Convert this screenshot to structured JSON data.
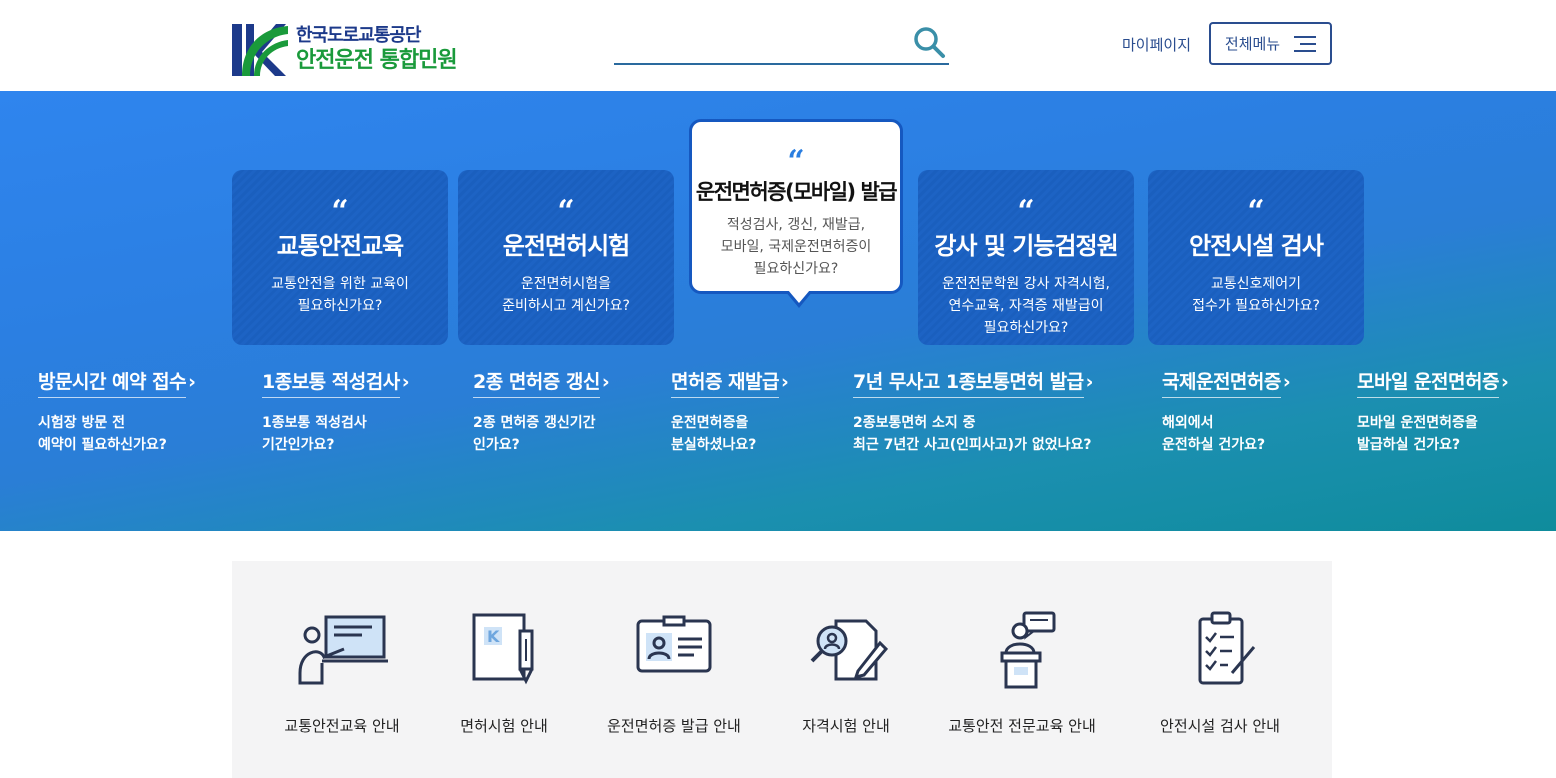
{
  "header": {
    "logo_line1": "한국도로교통공단",
    "logo_line2": "안전운전 통합민원",
    "search_placeholder": "",
    "mypage": "마이페이지",
    "menu": "전체메뉴"
  },
  "colors": {
    "brand_blue": "#1d3a8a",
    "brand_green": "#1a9a3b",
    "hero_blue": "#2b7fe2",
    "hero_teal": "#0f8c9c"
  },
  "cards": [
    {
      "title": "교통안전교육",
      "desc1": "교통안전을 위한 교육이",
      "desc2": "필요하신가요?",
      "desc3": ""
    },
    {
      "title": "운전면허시험",
      "desc1": "운전면허시험을",
      "desc2": "준비하시고 계신가요?",
      "desc3": ""
    },
    {
      "title": "운전면허증(모바일) 발급",
      "desc1": "적성검사, 갱신, 재발급,",
      "desc2": "모바일, 국제운전면허증이",
      "desc3": "필요하신가요?"
    },
    {
      "title": "강사 및 기능검정원",
      "desc1": "운전전문학원 강사 자격시험,",
      "desc2": "연수교육, 자격증 재발급이",
      "desc3": "필요하신가요?"
    },
    {
      "title": "안전시설 검사",
      "desc1": "교통신호제어기",
      "desc2": "접수가 필요하신가요?",
      "desc3": ""
    }
  ],
  "quote_mark": "“",
  "links": [
    {
      "title": "방문시간 예약 접수",
      "desc1": "시험장 방문 전",
      "desc2": "예약이 필요하신가요?"
    },
    {
      "title": "1종보통 적성검사",
      "desc1": "1종보통 적성검사",
      "desc2": "기간인가요?"
    },
    {
      "title": "2종 면허증 갱신",
      "desc1": "2종 면허증 갱신기간",
      "desc2": "인가요?"
    },
    {
      "title": "면허증 재발급",
      "desc1": "운전면허증을",
      "desc2": "분실하셨나요?"
    },
    {
      "title": "7년 무사고 1종보통면허 발급",
      "desc1": "2종보통면허 소지 중",
      "desc2": "최근 7년간 사고(인피사고)가 없었나요?"
    },
    {
      "title": "국제운전면허증",
      "desc1": "해외에서",
      "desc2": "운전하실 건가요?"
    },
    {
      "title": "모바일 운전면허증",
      "desc1": "모바일 운전면허증을",
      "desc2": "발급하실 건가요?"
    }
  ],
  "arrow": "›",
  "guide": [
    {
      "label": "교통안전교육 안내",
      "icon": "teacher-board-icon"
    },
    {
      "label": "면허시험 안내",
      "icon": "license-test-icon"
    },
    {
      "label": "운전면허증 발급 안내",
      "icon": "id-card-icon"
    },
    {
      "label": "자격시험 안내",
      "icon": "exam-search-icon"
    },
    {
      "label": "교통안전 전문교육 안내",
      "icon": "podium-speaker-icon"
    },
    {
      "label": "안전시설 검사 안내",
      "icon": "clipboard-check-icon"
    }
  ]
}
